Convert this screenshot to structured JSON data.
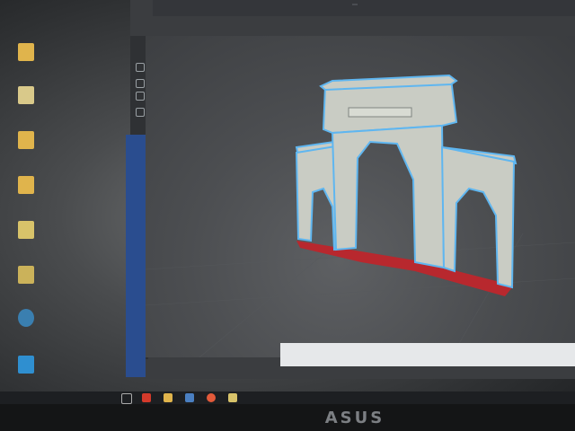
{
  "top_toolbar": {
    "tabs": [
      "",
      "",
      "",
      "",
      ""
    ]
  },
  "taskbar": {
    "icons": [
      "search-icon",
      "task-view-icon",
      "app-icon-1",
      "app-icon-2",
      "app-icon-3",
      "app-icon-4"
    ]
  },
  "monitor": {
    "brand": "ASUS"
  },
  "colors": {
    "model_outline": "#5fb6f0",
    "model_body": "#c9ccc4",
    "floor_red": "#b8282e",
    "blue_strip": "#2a4d8f"
  }
}
